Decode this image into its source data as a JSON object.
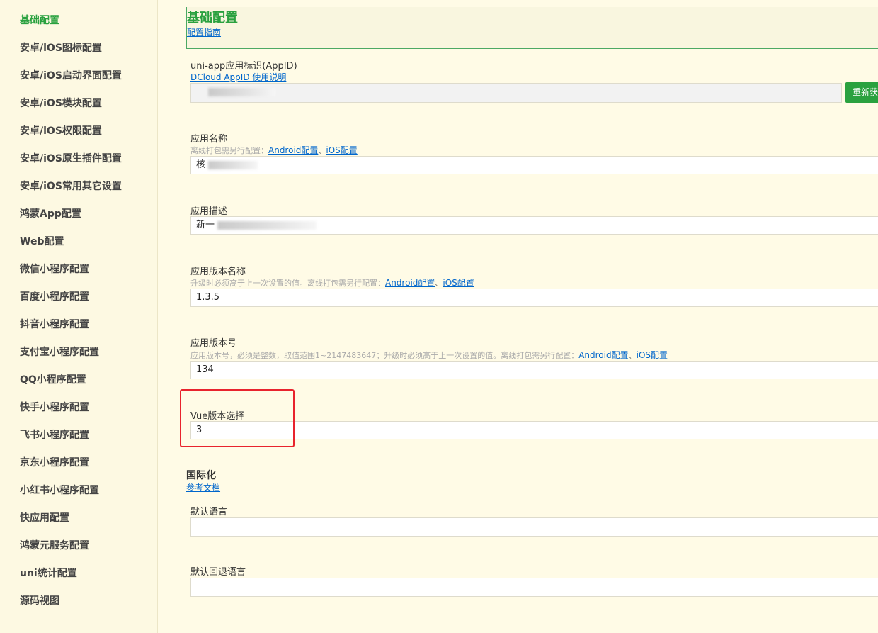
{
  "sidebar": {
    "items": [
      {
        "label": "基础配置",
        "active": true
      },
      {
        "label": "安卓/iOS图标配置"
      },
      {
        "label": "安卓/iOS启动界面配置"
      },
      {
        "label": "安卓/iOS模块配置"
      },
      {
        "label": "安卓/iOS权限配置"
      },
      {
        "label": "安卓/iOS原生插件配置"
      },
      {
        "label": "安卓/iOS常用其它设置"
      },
      {
        "label": "鸿蒙App配置"
      },
      {
        "label": "Web配置"
      },
      {
        "label": "微信小程序配置"
      },
      {
        "label": "百度小程序配置"
      },
      {
        "label": "抖音小程序配置"
      },
      {
        "label": "支付宝小程序配置"
      },
      {
        "label": "QQ小程序配置"
      },
      {
        "label": "快手小程序配置"
      },
      {
        "label": "飞书小程序配置"
      },
      {
        "label": "京东小程序配置"
      },
      {
        "label": "小红书小程序配置"
      },
      {
        "label": "快应用配置"
      },
      {
        "label": "鸿蒙元服务配置"
      },
      {
        "label": "uni统计配置"
      },
      {
        "label": "源码视图"
      }
    ]
  },
  "main": {
    "title": "基础配置",
    "guide_link": "配置指南",
    "appid": {
      "label": "uni-app应用标识(AppID)",
      "link": "DCloud AppID 使用说明",
      "value_prefix": "__",
      "button": "重新获取"
    },
    "app_name": {
      "label": "应用名称",
      "hint": "离线打包需另行配置：",
      "android_link": "Android配置",
      "ios_link": "iOS配置",
      "value_prefix": "核"
    },
    "app_desc": {
      "label": "应用描述",
      "value_prefix": "新一"
    },
    "version_name": {
      "label": "应用版本名称",
      "hint": "升级时必须高于上一次设置的值。离线打包需另行配置：",
      "android_link": "Android配置",
      "ios_link": "iOS配置",
      "value": "1.3.5"
    },
    "version_code": {
      "label": "应用版本号",
      "hint": "应用版本号，必须是整数，取值范围1~2147483647；升级时必须高于上一次设置的值。离线打包需另行配置：",
      "android_link": "Android配置",
      "ios_link": "iOS配置",
      "value": "134"
    },
    "vue_version": {
      "label": "Vue版本选择",
      "value": "3"
    },
    "i18n": {
      "title": "国际化",
      "link": "参考文档",
      "default_lang_label": "默认语言",
      "default_lang_value": "",
      "fallback_lang_label": "默认回退语言",
      "fallback_lang_value": ""
    },
    "separator": "、"
  },
  "colors": {
    "accent": "#2aa13f",
    "link": "#0066cc",
    "highlight": "#e8232d",
    "background": "#fffbe6"
  }
}
